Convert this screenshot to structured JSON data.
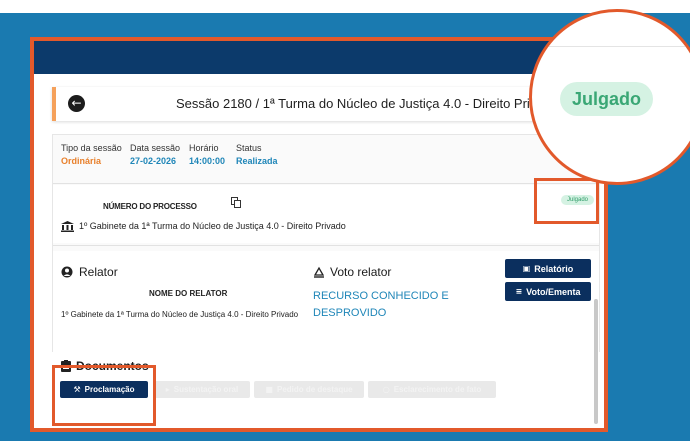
{
  "session": {
    "title": "Sessão 2180 / 1ª Turma do Núcleo de Justiça 4.0 - Direito Privado"
  },
  "meta": {
    "tipo_label": "Tipo da sessão",
    "tipo_value": "Ordinária",
    "data_label": "Data sessão",
    "data_value": "27-02-2026",
    "horario_label": "Horário",
    "horario_value": "14:00:00",
    "status_label": "Status",
    "status_value": "Realizada"
  },
  "process": {
    "numero_label": "NÚMERO DO PROCESSO",
    "badge": "Julgado",
    "gabinete": "1º Gabinete da 1ª Turma do Núcleo de Justiça 4.0 - Direito Privado"
  },
  "relator": {
    "heading": "Relator",
    "nome_label": "NOME DO RELATOR",
    "gabinete": "1º Gabinete da 1ª Turma do Núcleo de Justiça 4.0 - Direito Privado"
  },
  "voto": {
    "heading": "Voto relator",
    "text": "RECURSO CONHECIDO E DESPROVIDO",
    "relatorio_button": "Relatório",
    "voto_ementa_button": "Voto/Ementa"
  },
  "documentos": {
    "heading": "Documentos",
    "buttons": [
      "Proclamação",
      "Sustentação oral",
      "Pedido de destaque",
      "Esclarecimento de fato"
    ]
  },
  "zoom": {
    "badge": "Julgado"
  },
  "colors": {
    "highlight": "#e2592b",
    "navy": "#0c3a6b",
    "background": "#1a7ab0",
    "badge_text": "#3aa775",
    "badge_bg": "#d5f2e3"
  },
  "icons": [
    "back-arrow-icon",
    "copy-icon",
    "bank-icon",
    "user-icon",
    "gavel-vote-icon",
    "report-icon",
    "list-icon",
    "document-icon",
    "gavel-icon",
    "megaphone-icon",
    "chat-icon",
    "question-icon"
  ]
}
